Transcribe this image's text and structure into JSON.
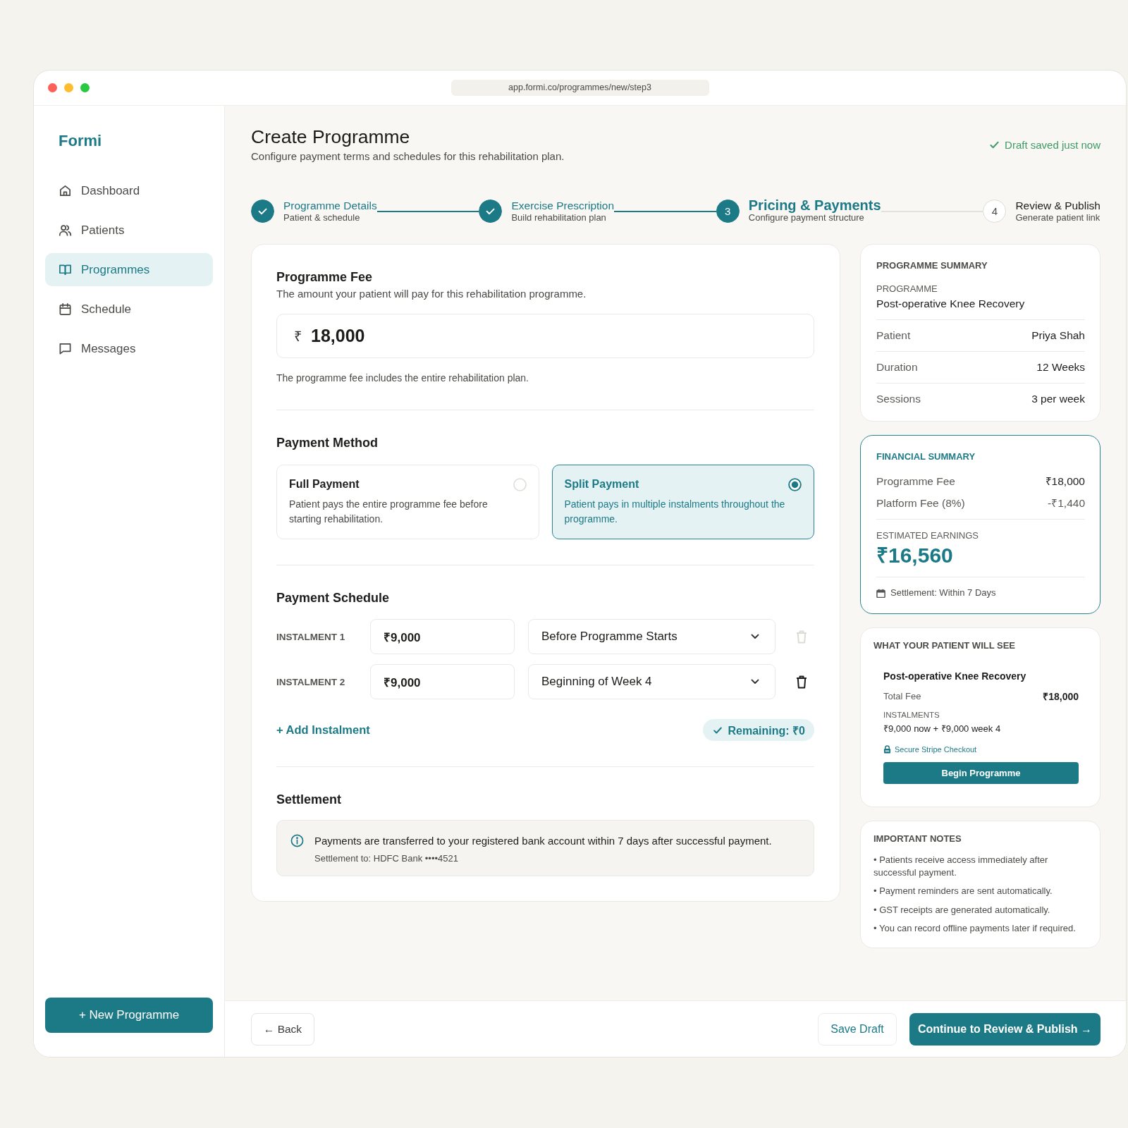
{
  "window": {
    "address": "app.formi.co/programmes/new/step3"
  },
  "sidebar": {
    "brand": "Formi",
    "items": [
      {
        "label": "Dashboard",
        "selected": false
      },
      {
        "label": "Patients",
        "selected": false
      },
      {
        "label": "Programmes",
        "selected": true
      },
      {
        "label": "Schedule",
        "selected": false
      },
      {
        "label": "Messages",
        "selected": false
      }
    ],
    "new_button": "+ New Programme"
  },
  "header": {
    "title": "Create Programme",
    "subtitle": "Configure payment terms and schedules for this rehabilitation plan.",
    "save_status": "Draft saved just now"
  },
  "stepper": [
    {
      "title": "Programme Details",
      "caption": "Patient & schedule",
      "completed": true,
      "current": false
    },
    {
      "title": "Exercise Prescription",
      "caption": "Build rehabilitation plan",
      "completed": true,
      "current": false
    },
    {
      "number": "3",
      "title": "Pricing & Payments",
      "caption": "Configure payment structure",
      "completed": false,
      "current": true
    },
    {
      "number": "4",
      "title": "Review & Publish",
      "caption": "Generate patient link",
      "completed": false,
      "current": false
    }
  ],
  "programme_fee": {
    "title": "Programme Fee",
    "description": "The amount your patient will pay for this rehabilitation programme.",
    "currency": "₹",
    "value": "18,000",
    "hint": "The programme fee includes the entire rehabilitation plan."
  },
  "payment_method": {
    "title": "Payment Method",
    "options": [
      {
        "title": "Full Payment",
        "description": "Patient pays the entire programme fee before starting rehabilitation.",
        "selected": false
      },
      {
        "title": "Split Payment",
        "description": "Patient pays in multiple instalments throughout the programme.",
        "selected": true
      }
    ]
  },
  "payment_schedule": {
    "title": "Payment Schedule",
    "instalments": [
      {
        "label": "INSTALMENT 1",
        "amount": "₹9,000",
        "timing": "Before Programme Starts",
        "delete_disabled": true
      },
      {
        "label": "INSTALMENT 2",
        "amount": "₹9,000",
        "timing": "Beginning of Week 4",
        "delete_disabled": false
      }
    ],
    "add_label": "+ Add Instalment",
    "remaining": "Remaining: ₹0"
  },
  "settlement": {
    "title": "Settlement",
    "message": "Payments are transferred to your registered bank account within 7 days after successful payment.",
    "account": "Settlement to: HDFC Bank ••••4521"
  },
  "programme_summary": {
    "title": "PROGRAMME SUMMARY",
    "programme_label": "PROGRAMME",
    "programme_name": "Post-operative Knee Recovery",
    "rows": [
      {
        "label": "Patient",
        "value": "Priya Shah"
      },
      {
        "label": "Duration",
        "value": "12 Weeks"
      },
      {
        "label": "Sessions",
        "value": "3 per week"
      }
    ]
  },
  "financial_summary": {
    "title": "FINANCIAL SUMMARY",
    "rows": [
      {
        "label": "Programme Fee",
        "value": "₹18,000"
      },
      {
        "label": "Platform Fee (8%)",
        "value": "-₹1,440"
      }
    ],
    "earnings_label": "ESTIMATED EARNINGS",
    "earnings": "₹16,560",
    "settlement": "Settlement: Within 7 Days"
  },
  "patient_preview": {
    "title": "WHAT YOUR PATIENT WILL SEE",
    "programme_name": "Post-operative Knee Recovery",
    "total_label": "Total Fee",
    "total": "₹18,000",
    "instalments_label": "INSTALMENTS",
    "instalments": "₹9,000 now + ₹9,000 week 4",
    "secure_note": "Secure Stripe Checkout",
    "button": "Begin Programme"
  },
  "important_notes": {
    "title": "IMPORTANT NOTES",
    "items": [
      "• Patients receive access immediately after successful payment.",
      "• Payment reminders are sent automatically.",
      "• GST receipts are generated automatically.",
      "• You can record offline payments later if required."
    ]
  },
  "footer": {
    "back": "← Back",
    "save_draft": "Save Draft",
    "continue": "Continue to Review & Publish →"
  }
}
